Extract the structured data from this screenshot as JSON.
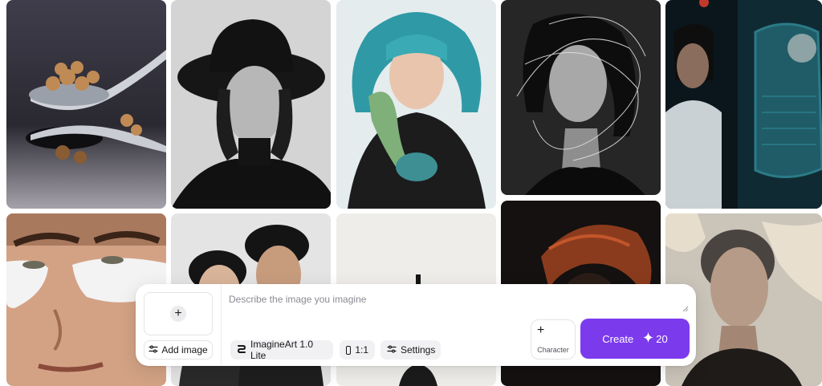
{
  "gallery": {
    "images": [
      {
        "name": "sugar-spoon-image",
        "palette": [
          "#3a3846",
          "#1c1b22"
        ]
      },
      {
        "name": "woman-black-hat-image",
        "palette": [
          "#d9d9d9",
          "#1a1a1a"
        ]
      },
      {
        "name": "teal-hair-girl-image",
        "palette": [
          "#e7eef0",
          "#2fa3ad"
        ]
      },
      {
        "name": "line-art-portrait-image",
        "palette": [
          "#2a2a2a",
          "#0f0f0f"
        ]
      },
      {
        "name": "scifi-window-image",
        "palette": [
          "#0d1a22",
          "#1e5a66"
        ]
      },
      {
        "name": "eye-patches-man-image",
        "palette": [
          "#d9a88a",
          "#b27a5c"
        ]
      },
      {
        "name": "couple-portrait-image",
        "palette": [
          "#e6e6e6",
          "#222222"
        ]
      },
      {
        "name": "minimal-silhouette-image",
        "palette": [
          "#f0eeeb",
          "#1b1b1b"
        ]
      },
      {
        "name": "red-hair-dark-image",
        "palette": [
          "#15110f",
          "#8a3a1e"
        ]
      },
      {
        "name": "shaved-head-woman-image",
        "palette": [
          "#c9c3b8",
          "#3b3735"
        ]
      }
    ]
  },
  "composer": {
    "add_image_label": "Add image",
    "prompt_placeholder": "Describe the image you imagine",
    "prompt_value": "",
    "model_label": "ImagineArt 1.0 Lite",
    "ratio_label": "1:1",
    "settings_label": "Settings",
    "character_label": "Character",
    "create_label": "Create",
    "credits": "20",
    "accent_color": "#7c3aed"
  }
}
